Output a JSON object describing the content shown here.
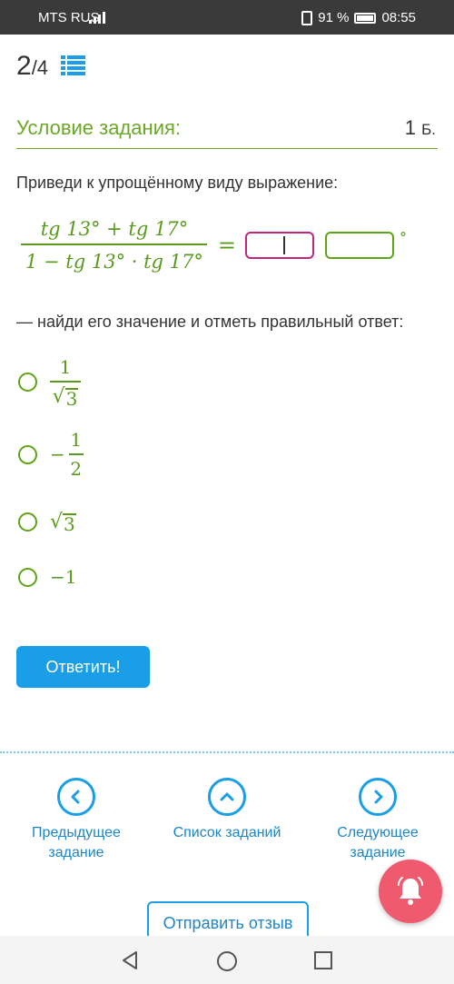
{
  "status_bar": {
    "carrier": "MTS RUS",
    "battery": "91 %",
    "time": "08:55"
  },
  "progress": {
    "current": "2",
    "total": "/4"
  },
  "task": {
    "title": "Условие задания:",
    "points_value": "1",
    "points_unit": "Б.",
    "prompt": "Приведи к упрощённому виду выражение:",
    "expression": {
      "numerator": "tg 13° + tg 17°",
      "denominator": "1 − tg 13° · tg 17°",
      "equals": "=",
      "degree": "°"
    },
    "instruction": "— найди его значение и отметь правильный ответ:"
  },
  "options": [
    {
      "label": "1/√3",
      "num": "1",
      "rad": "3"
    },
    {
      "label": "−1/2",
      "sign": "−",
      "num": "1",
      "den": "2"
    },
    {
      "label": "√3",
      "rad": "3"
    },
    {
      "label": "−1",
      "text": "−1"
    }
  ],
  "answer_button": "Ответить!",
  "nav": {
    "prev_line1": "Предыдущее",
    "prev_line2": "задание",
    "list": "Список заданий",
    "next_line1": "Следующее",
    "next_line2": "задание"
  },
  "feedback_button": "Отправить отзыв",
  "colors": {
    "accent_green": "#6aa825",
    "math_green": "#5a9a1e",
    "active_input": "#c2267d",
    "button_blue": "#1b9ee8",
    "bell_red": "#ef5a6e"
  }
}
